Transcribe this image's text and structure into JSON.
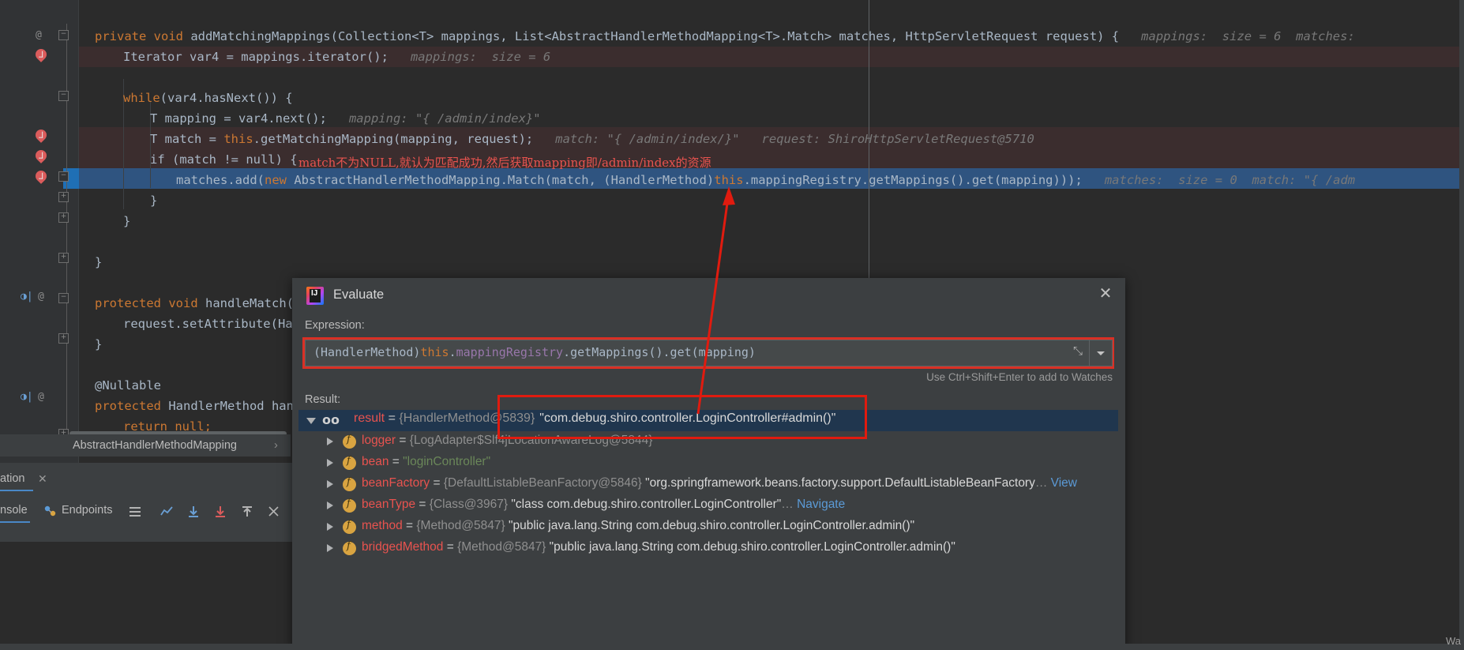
{
  "editor": {
    "code_lines": [
      {
        "indent": 20,
        "segments": [
          {
            "t": "private ",
            "c": "kw"
          },
          {
            "t": "void ",
            "c": "kw"
          },
          {
            "t": "addMatchingMappings",
            "c": "ident"
          },
          {
            "t": "(Collection<T> mappings, List<AbstractHandlerMethodMapping<T>.Match> matches, HttpServletRequest request) {",
            "c": "ident"
          },
          {
            "t": "   mappings:  size = 6  matches:",
            "c": "hint"
          }
        ]
      },
      {
        "indent": 56,
        "segments": [
          {
            "t": "Iterator var4 = mappings.iterator();",
            "c": "ident"
          },
          {
            "t": "   mappings:  size = 6",
            "c": "hint"
          }
        ]
      },
      {
        "indent": 56,
        "segments": []
      },
      {
        "indent": 56,
        "segments": [
          {
            "t": "while",
            "c": "kw"
          },
          {
            "t": "(var4.hasNext()) {",
            "c": "ident"
          }
        ]
      },
      {
        "indent": 90,
        "segments": [
          {
            "t": "T mapping = var4.next();",
            "c": "ident"
          },
          {
            "t": "   mapping: \"{ /admin/index}\"",
            "c": "hint"
          }
        ]
      },
      {
        "indent": 90,
        "segments": [
          {
            "t": "T match = ",
            "c": "ident"
          },
          {
            "t": "this",
            "c": "kw"
          },
          {
            "t": ".getMatchingMapping(mapping, request);",
            "c": "ident"
          },
          {
            "t": "   match: \"{ /admin/index/}\"   request: ShiroHttpServletRequest@5710",
            "c": "hint"
          }
        ]
      },
      {
        "indent": 90,
        "segments": [
          {
            "t": "if (match != null) {",
            "c": "ident"
          }
        ]
      },
      {
        "indent": 123,
        "segments": [
          {
            "t": "matches.add(",
            "c": "ident"
          },
          {
            "t": "new ",
            "c": "kw"
          },
          {
            "t": "AbstractHandlerMethodMapping.Match(match, ",
            "c": "ident"
          },
          {
            "t": "(HandlerMethod)",
            "c": "ident"
          },
          {
            "t": "this",
            "c": "kw"
          },
          {
            "t": ".mappingRegistry.getMappings().get(mapping)));",
            "c": "ident"
          },
          {
            "t": "   matches:  size = 0  match: \"{ /adm",
            "c": "hint"
          }
        ]
      },
      {
        "indent": 90,
        "segments": [
          {
            "t": "}",
            "c": "ident"
          }
        ]
      },
      {
        "indent": 56,
        "segments": [
          {
            "t": "}",
            "c": "ident"
          }
        ]
      },
      {
        "indent": 56,
        "segments": []
      },
      {
        "indent": 20,
        "segments": [
          {
            "t": "}",
            "c": "ident"
          }
        ]
      },
      {
        "indent": 20,
        "segments": []
      },
      {
        "indent": 20,
        "segments": [
          {
            "t": "protected ",
            "c": "kw"
          },
          {
            "t": "void ",
            "c": "kw"
          },
          {
            "t": "handleMatch(T",
            "c": "ident"
          }
        ]
      },
      {
        "indent": 56,
        "segments": [
          {
            "t": "request.setAttribute(Hand",
            "c": "ident"
          }
        ]
      },
      {
        "indent": 20,
        "segments": [
          {
            "t": "}",
            "c": "ident"
          }
        ]
      },
      {
        "indent": 20,
        "segments": []
      },
      {
        "indent": 20,
        "segments": [
          {
            "t": "@Nullable",
            "c": "ident"
          }
        ]
      },
      {
        "indent": 20,
        "segments": [
          {
            "t": "protected ",
            "c": "kw"
          },
          {
            "t": "HandlerMethod handl",
            "c": "ident"
          }
        ]
      },
      {
        "indent": 56,
        "segments": [
          {
            "t": "return ",
            "c": "kw"
          },
          {
            "t": "null;",
            "c": "kw"
          }
        ]
      },
      {
        "indent": 20,
        "segments": [
          {
            "t": "}",
            "c": "ident"
          }
        ]
      }
    ],
    "chinese_annotation": "match不为NULL,就认为匹配成功,然后获取mapping即/admin/index的资源",
    "breadcrumb": "AbstractHandlerMethodMapping",
    "breadcrumb_chevron": "›"
  },
  "bottom_tools": {
    "tab_left_label": "ation",
    "tab_left_close": "✕",
    "tab_console": "nsole",
    "tab_endpoints": "Endpoints"
  },
  "evaluate": {
    "title": "Evaluate",
    "close_icon": "✕",
    "expression_label": "Expression:",
    "expression_value": "(HandlerMethod)this.mappingRegistry.getMappings().get(mapping)",
    "expression_parts": {
      "p1": "(HandlerMethod)",
      "p2": "this",
      "p3": ".",
      "p4": "mappingRegistry",
      "p5": ".getMappings().get(mapping)"
    },
    "expand_icon": "⤡",
    "watches_hint": "Use Ctrl+Shift+Enter to add to Watches",
    "result_label": "Result:",
    "result_row": {
      "name": "result",
      "eq": " = ",
      "ref": "{HandlerMethod@5839}",
      "value": "\"com.debug.shiro.controller.LoginController#admin()\""
    },
    "tree_rows": [
      {
        "name": "logger",
        "ref": "{LogAdapter$Slf4jLocationAwareLog@5844}",
        "value": "",
        "extra": "",
        "link": ""
      },
      {
        "name": "bean",
        "ref": "",
        "value": "\"loginController\"",
        "extra": "",
        "link": "",
        "value_style": "green"
      },
      {
        "name": "beanFactory",
        "ref": "{DefaultListableBeanFactory@5846}",
        "value": "\"org.springframework.beans.factory.support.DefaultListableBeanFactory",
        "extra": "…",
        "link": "View"
      },
      {
        "name": "beanType",
        "ref": "{Class@3967}",
        "value": "\"class com.debug.shiro.controller.LoginController\"",
        "extra": "…",
        "link": "Navigate"
      },
      {
        "name": "method",
        "ref": "{Method@5847}",
        "value": "\"public java.lang.String com.debug.shiro.controller.LoginController.admin()\"",
        "extra": "",
        "link": ""
      },
      {
        "name": "bridgedMethod",
        "ref": "{Method@5847}",
        "value": "\"public java.lang.String com.debug.shiro.controller.LoginController.admin()\"",
        "extra": "",
        "link": ""
      }
    ]
  },
  "status": {
    "warning_text": "Wa"
  },
  "colors": {
    "editor_bg": "#2b2b2b",
    "panel_bg": "#3c3f41",
    "accent_blue": "#2f5480",
    "highlight_red": "#3b2d2e",
    "annotation_red": "#e8534f",
    "box_red": "#d93025",
    "keyword_orange": "#cc7832",
    "method_yellow": "#ffc66d",
    "string_green": "#6a8759",
    "field_purple": "#9876aa"
  }
}
